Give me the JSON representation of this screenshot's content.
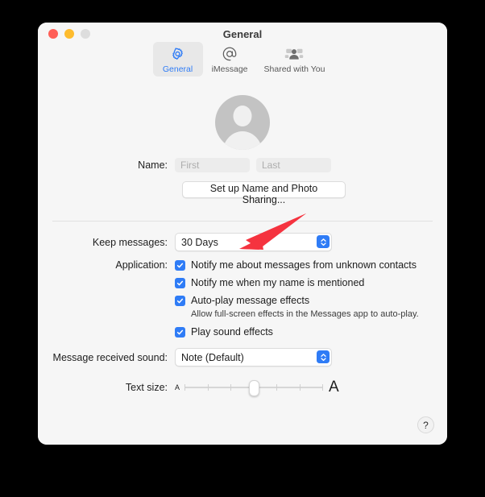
{
  "window": {
    "title": "General",
    "traffic_lights": [
      "close",
      "minimize",
      "zoom"
    ]
  },
  "toolbar": {
    "tabs": [
      {
        "id": "general",
        "label": "General",
        "icon": "gear-icon",
        "selected": true
      },
      {
        "id": "imessage",
        "label": "iMessage",
        "icon": "at-sign-icon",
        "selected": false
      },
      {
        "id": "shared-with-you",
        "label": "Shared with You",
        "icon": "people-icon",
        "selected": false
      }
    ]
  },
  "profile": {
    "avatar_icon": "person-placeholder-icon",
    "name_label": "Name:",
    "first_name_value": "",
    "first_name_placeholder": "First",
    "last_name_value": "",
    "last_name_placeholder": "Last",
    "setup_button_label": "Set up Name and Photo Sharing..."
  },
  "settings": {
    "keep_messages_label": "Keep messages:",
    "keep_messages_value": "30 Days",
    "application_label": "Application:",
    "checkboxes": [
      {
        "label": "Notify me about messages from unknown contacts",
        "checked": true
      },
      {
        "label": "Notify me when my name is mentioned",
        "checked": true
      },
      {
        "label": "Auto-play message effects",
        "checked": true
      },
      {
        "label": "Play sound effects",
        "checked": true
      }
    ],
    "autoplay_sub_label": "Allow full-screen effects in the Messages app to auto-play.",
    "sound_label": "Message received sound:",
    "sound_value": "Note (Default)",
    "text_size_label": "Text size:",
    "text_size_small_glyph": "A",
    "text_size_large_glyph": "A",
    "text_size_ticks": 7,
    "text_size_position": 4
  },
  "help": {
    "label": "?"
  },
  "annotation": {
    "arrow_color": "#f5333f",
    "points_to": "keep-messages-popup"
  },
  "colors": {
    "accent": "#2f7cf6",
    "window_bg": "#f6f6f6",
    "annotation_red": "#f5333f",
    "traffic_red": "#ff5f57",
    "traffic_yellow": "#febc2e",
    "traffic_gray": "#dddddd"
  }
}
